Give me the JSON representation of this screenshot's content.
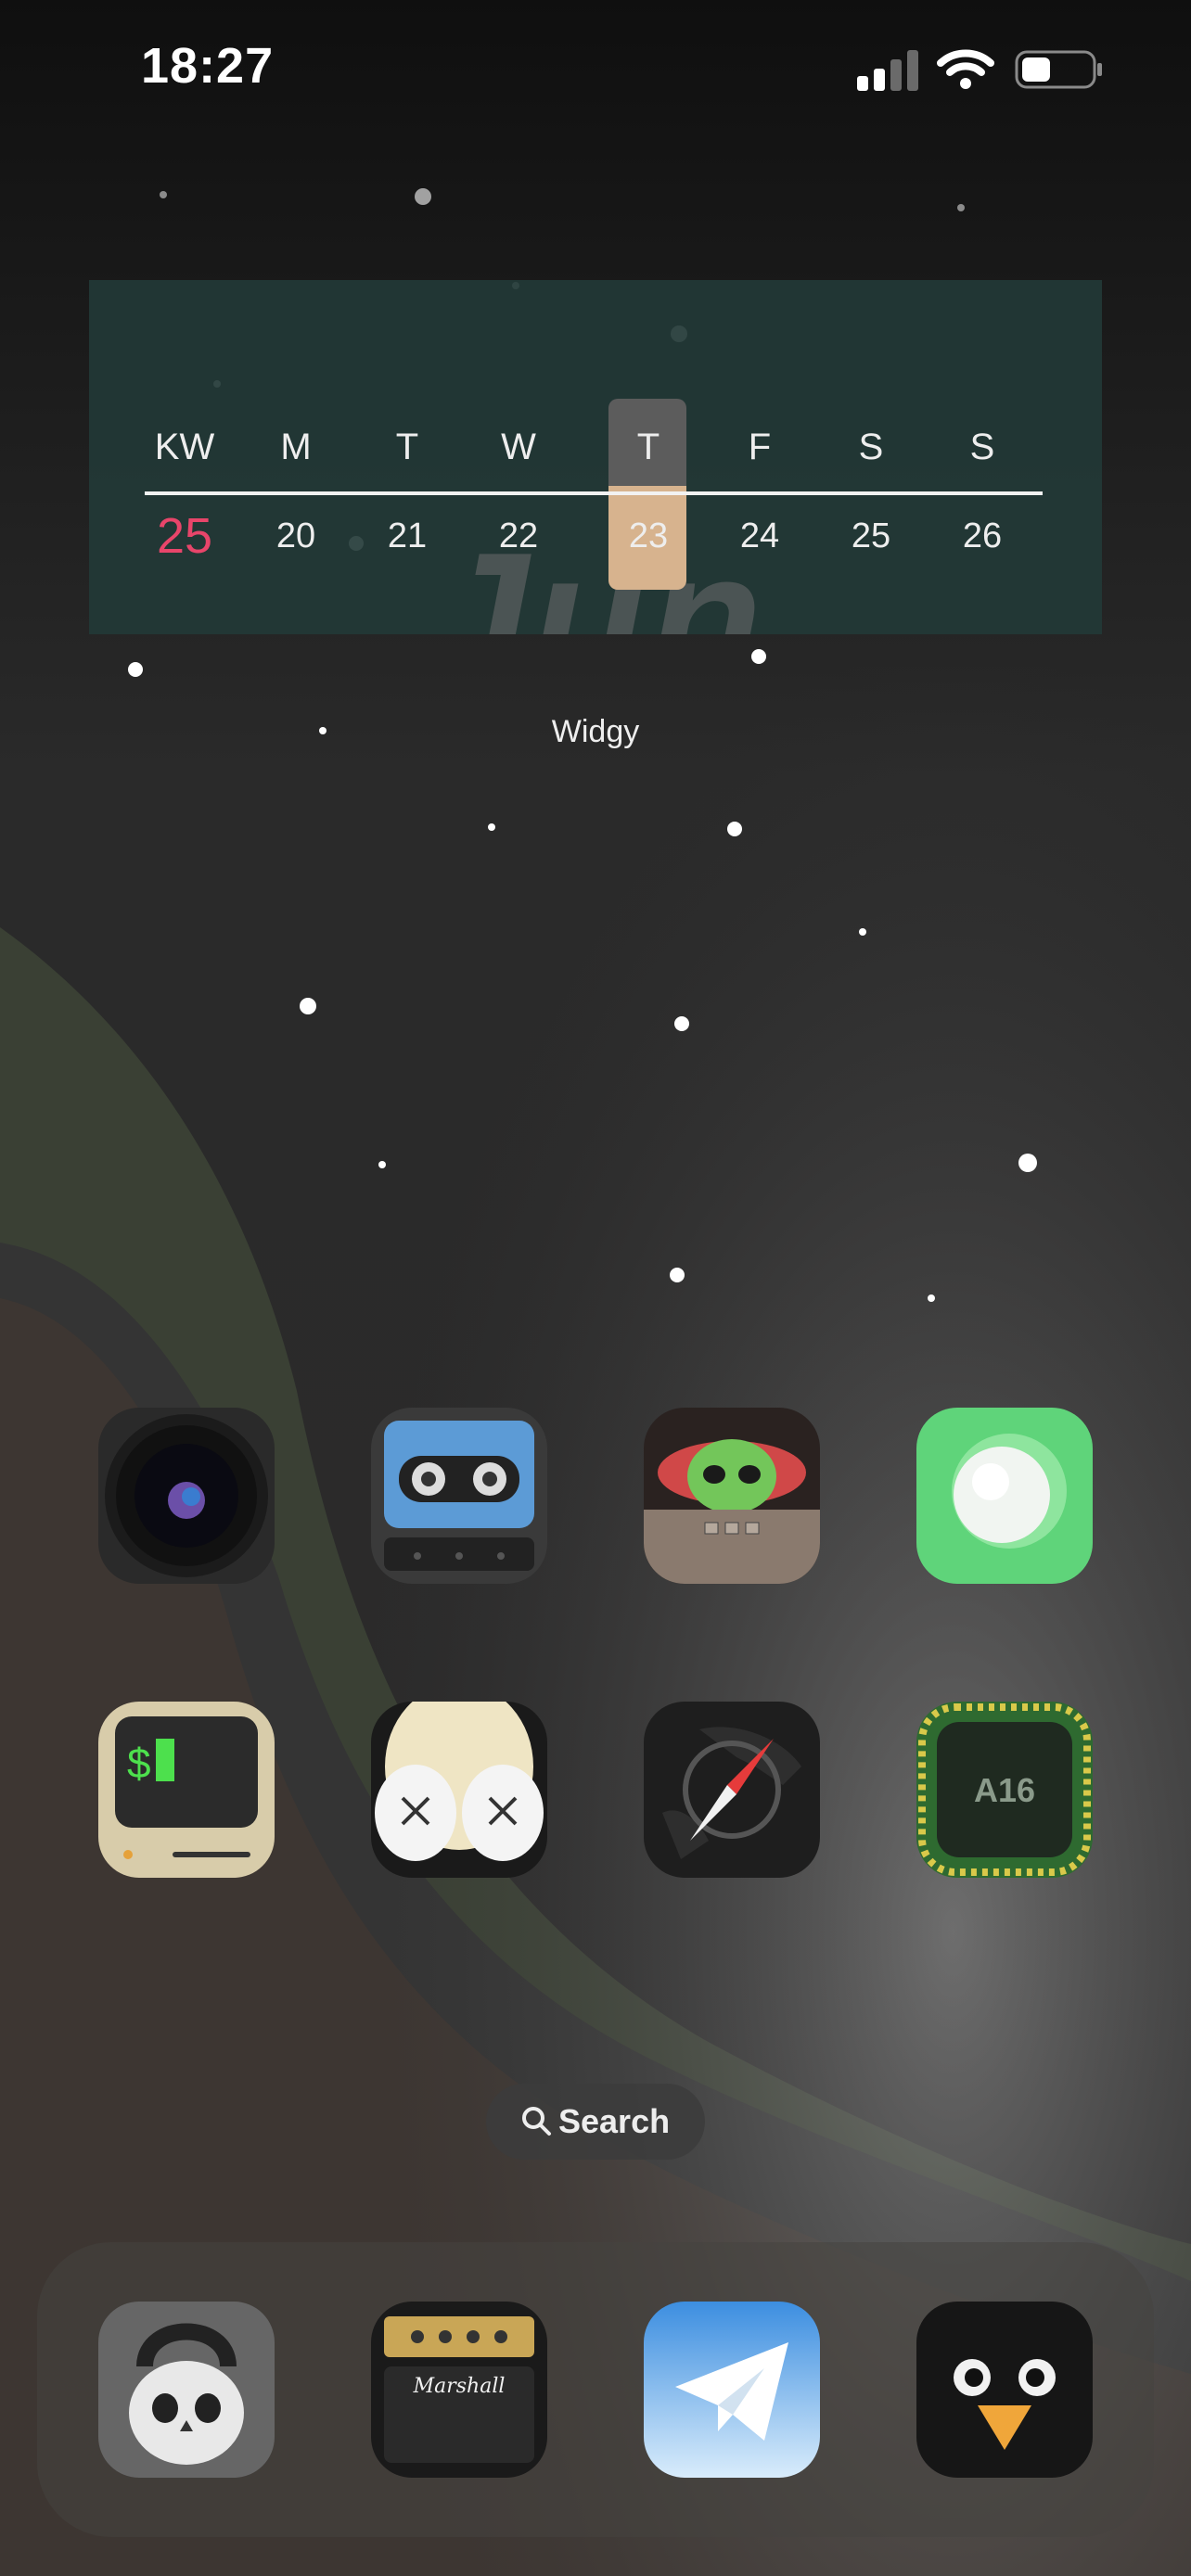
{
  "status_bar": {
    "time": "18:27"
  },
  "widget": {
    "month": "Jun",
    "header": [
      "KW",
      "M",
      "T",
      "W",
      "T",
      "F",
      "S",
      "S"
    ],
    "week_number": "25",
    "days": [
      "20",
      "21",
      "22",
      "23",
      "24",
      "25",
      "26"
    ],
    "label": "Widgy"
  },
  "search": {
    "label": "Search"
  },
  "colors": {
    "week_number": "#e8456a",
    "today_highlight": "#d7b38e",
    "widget_bg": "#223a38"
  },
  "home_icons": [
    "camera-lens-icon",
    "cassette-tape-icon",
    "baby-yoda-icon",
    "green-orb-icon",
    "terminal-computer-icon",
    "kaws-hands-icon",
    "safari-compass-icon",
    "a16-chip-icon"
  ],
  "dock_icons": [
    "kettlebell-skull-icon",
    "marshall-amp-icon",
    "telegram-icon",
    "penguin-bird-icon"
  ]
}
